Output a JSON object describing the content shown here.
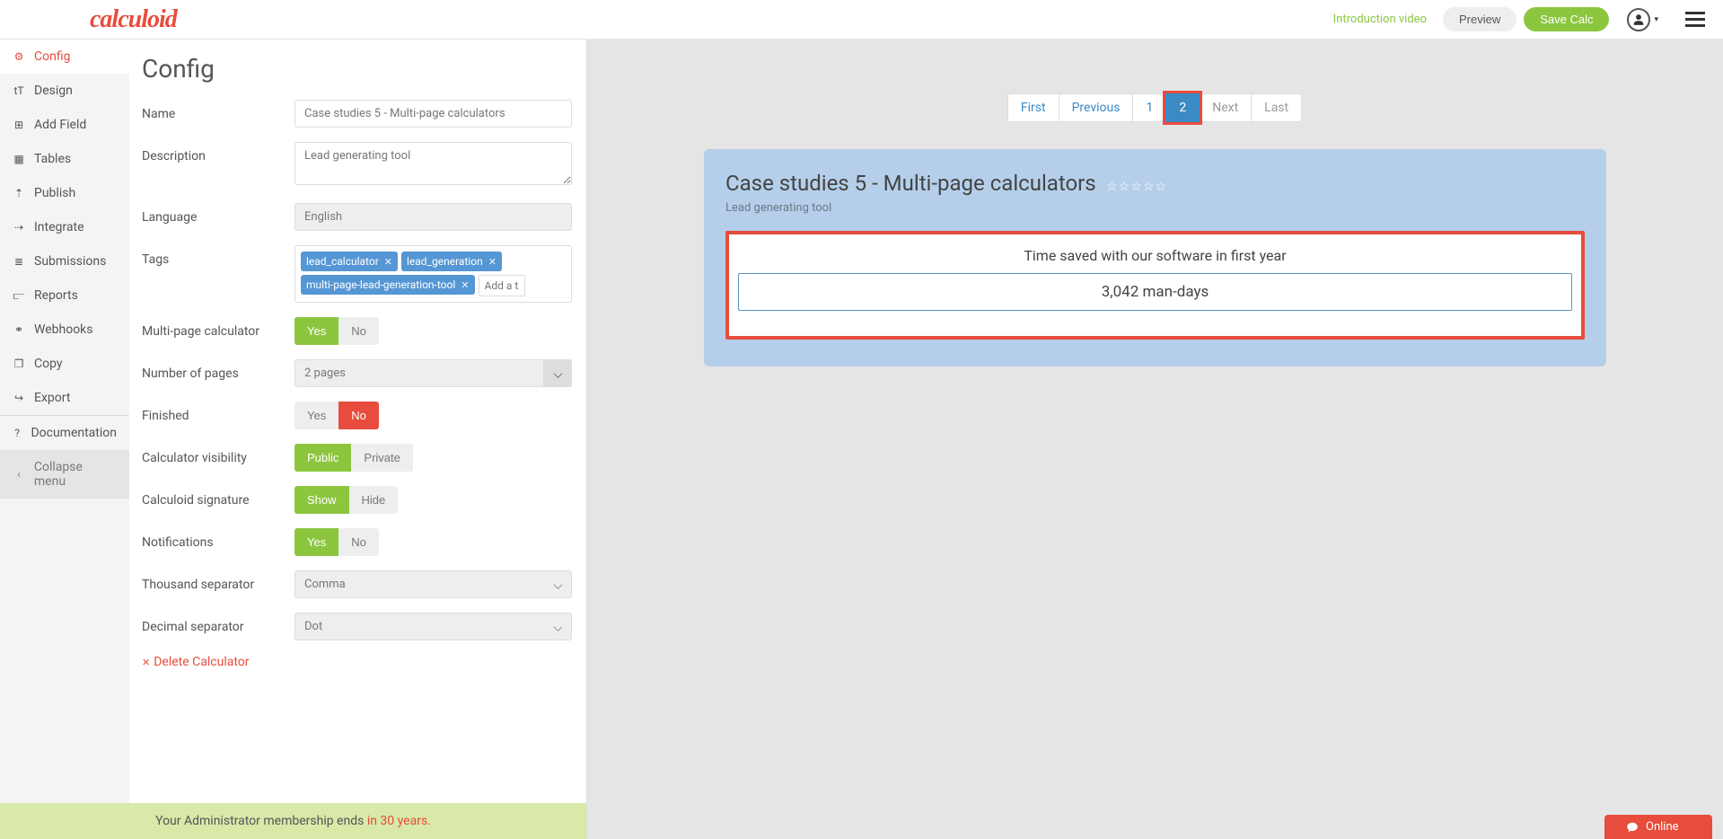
{
  "header": {
    "logo": "calculoid",
    "intro_video": "Introduction video",
    "preview": "Preview",
    "save": "Save Calc"
  },
  "sidebar": {
    "items": [
      {
        "label": "Config",
        "icon": "⚙"
      },
      {
        "label": "Design",
        "icon": "tT"
      },
      {
        "label": "Add Field",
        "icon": "⊞"
      },
      {
        "label": "Tables",
        "icon": "▦"
      },
      {
        "label": "Publish",
        "icon": "⇡"
      },
      {
        "label": "Integrate",
        "icon": "⇢"
      },
      {
        "label": "Submissions",
        "icon": "≣"
      },
      {
        "label": "Reports",
        "icon": "⫍"
      },
      {
        "label": "Webhooks",
        "icon": "⚭"
      },
      {
        "label": "Copy",
        "icon": "❐"
      },
      {
        "label": "Export",
        "icon": "↪"
      },
      {
        "label": "Documentation",
        "icon": "?"
      },
      {
        "label": "Collapse menu",
        "icon": "‹"
      }
    ]
  },
  "config": {
    "title": "Config",
    "fields": {
      "name": {
        "label": "Name",
        "value": "Case studies 5 - Multi-page calculators"
      },
      "description": {
        "label": "Description",
        "value": "Lead generating tool"
      },
      "language": {
        "label": "Language",
        "value": "English"
      },
      "tags": {
        "label": "Tags",
        "values": [
          "lead_calculator",
          "lead_generation",
          "multi-page-lead-generation-tool"
        ],
        "placeholder": "Add a ta"
      },
      "multipage": {
        "label": "Multi-page calculator",
        "yes": "Yes",
        "no": "No"
      },
      "pages": {
        "label": "Number of pages",
        "value": "2 pages"
      },
      "finished": {
        "label": "Finished",
        "yes": "Yes",
        "no": "No"
      },
      "visibility": {
        "label": "Calculator visibility",
        "public": "Public",
        "private": "Private"
      },
      "signature": {
        "label": "Calculoid signature",
        "show": "Show",
        "hide": "Hide"
      },
      "notifications": {
        "label": "Notifications",
        "yes": "Yes",
        "no": "No"
      },
      "thousand": {
        "label": "Thousand separator",
        "value": "Comma"
      },
      "decimal": {
        "label": "Decimal separator",
        "value": "Dot"
      }
    },
    "delete": "Delete Calculator"
  },
  "membership": {
    "text": "Your Administrator membership ends ",
    "expiry": "in 30 years."
  },
  "pager": {
    "first": "First",
    "previous": "Previous",
    "p1": "1",
    "p2": "2",
    "next": "Next",
    "last": "Last"
  },
  "preview": {
    "title": "Case studies 5 - Multi-page calculators",
    "subtitle": "Lead generating tool",
    "result_heading": "Time saved with our software in first year",
    "result_value": "3,042 man-days"
  },
  "chat": {
    "label": "Online"
  }
}
